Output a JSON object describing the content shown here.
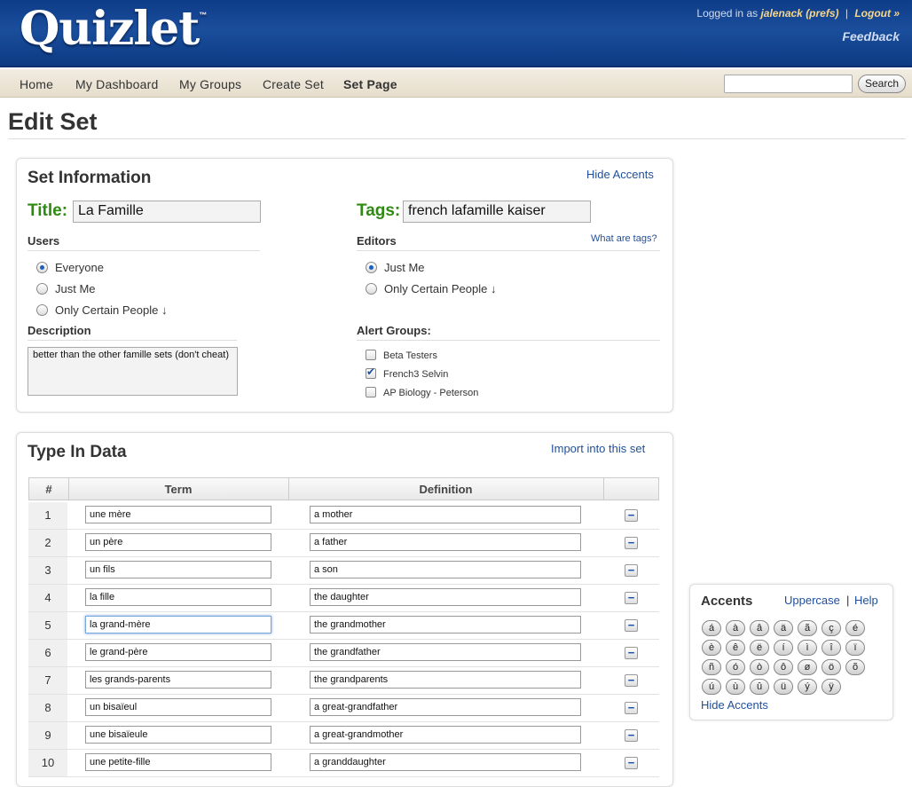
{
  "header": {
    "logo": "Quizlet",
    "logo_tm": "™",
    "logged_in_prefix": "Logged in as",
    "username": "jalenack",
    "prefs": "(prefs)",
    "separator": "|",
    "logout": "Logout »",
    "feedback": "Feedback"
  },
  "nav": {
    "items": [
      "Home",
      "My Dashboard",
      "My Groups",
      "Create Set",
      "Set Page"
    ],
    "current": "Set Page",
    "search_value": "",
    "search_button": "Search"
  },
  "page": {
    "title": "Edit Set"
  },
  "set_info": {
    "heading": "Set Information",
    "hide_accents": "Hide Accents",
    "title_label": "Title:",
    "title_value": "La Famille",
    "tags_label": "Tags:",
    "tags_value": "french lafamille kaiser",
    "what_are_tags": "What are tags?",
    "users_label": "Users",
    "users_options": [
      "Everyone",
      "Just Me",
      "Only Certain People ↓"
    ],
    "users_selected": "Everyone",
    "editors_label": "Editors",
    "editors_options": [
      "Just Me",
      "Only Certain People ↓"
    ],
    "editors_selected": "Just Me",
    "description_label": "Description",
    "description_value": "better than the other famille sets (don't cheat)",
    "alert_groups_label": "Alert Groups:",
    "alert_groups": [
      {
        "name": "Beta Testers",
        "checked": false
      },
      {
        "name": "French3 Selvin",
        "checked": true
      },
      {
        "name": "AP Biology - Peterson",
        "checked": false
      }
    ]
  },
  "data_panel": {
    "heading": "Type In Data",
    "import_link": "Import into this set",
    "col_num": "#",
    "col_term": "Term",
    "col_definition": "Definition",
    "remove_symbol": "−",
    "rows": [
      {
        "num": "1",
        "term": "une mère",
        "definition": "a mother"
      },
      {
        "num": "2",
        "term": "un père",
        "definition": "a father"
      },
      {
        "num": "3",
        "term": "un fils",
        "definition": "a son"
      },
      {
        "num": "4",
        "term": "la fille",
        "definition": "the daughter"
      },
      {
        "num": "5",
        "term": "la grand-mère",
        "definition": "the grandmother"
      },
      {
        "num": "6",
        "term": "le grand-père",
        "definition": "the grandfather"
      },
      {
        "num": "7",
        "term": "les grands-parents",
        "definition": "the grandparents"
      },
      {
        "num": "8",
        "term": "un bisaïeul",
        "definition": "a great-grandfather"
      },
      {
        "num": "9",
        "term": "une bisaïeule",
        "definition": "a great-grandmother"
      },
      {
        "num": "10",
        "term": "une petite-fille",
        "definition": "a granddaughter"
      }
    ],
    "focused_row": "5"
  },
  "accents": {
    "heading": "Accents",
    "uppercase": "Uppercase",
    "separator": "|",
    "help": "Help",
    "hide": "Hide Accents",
    "keys": [
      "á",
      "à",
      "â",
      "ä",
      "ã",
      "ç",
      "é",
      "è",
      "ê",
      "ë",
      "í",
      "ì",
      "î",
      "ï",
      "ñ",
      "ó",
      "ò",
      "ô",
      "ø",
      "ö",
      "õ",
      "ú",
      "ù",
      "û",
      "ü",
      "ý",
      "ÿ"
    ]
  }
}
